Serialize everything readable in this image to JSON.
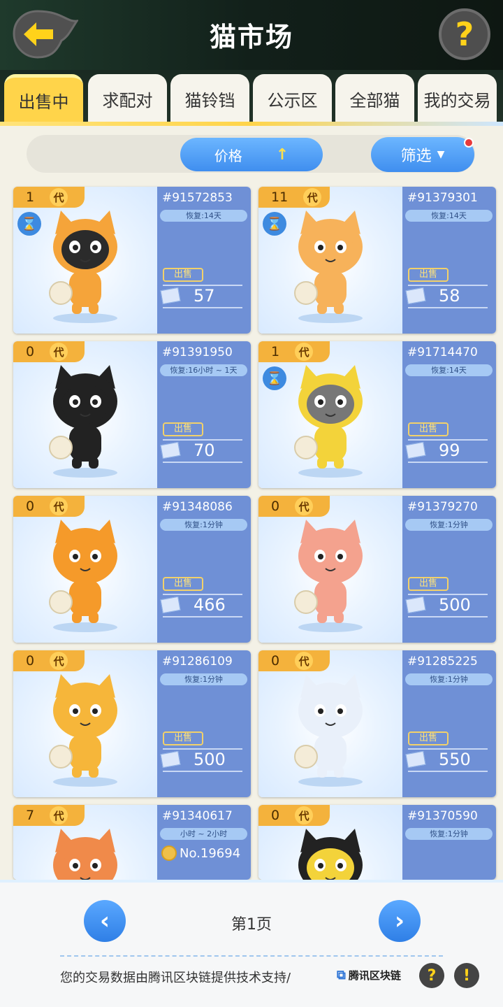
{
  "header": {
    "title": "猫市场",
    "back_icon": "back-arrow-icon",
    "help_label": "?"
  },
  "tabs": [
    {
      "label": "出售中",
      "active": true
    },
    {
      "label": "求配对",
      "active": false
    },
    {
      "label": "猫铃铛",
      "active": false
    },
    {
      "label": "公示区",
      "active": false
    },
    {
      "label": "全部猫",
      "active": false
    },
    {
      "label": "我的交易",
      "active": false
    }
  ],
  "sort": {
    "price_label": "价格",
    "price_arrow": "↑",
    "filter_label": "筛选",
    "filter_icon": "▼"
  },
  "cards": [
    {
      "gen": "1",
      "gen_tag": "代",
      "id": "#91572853",
      "recover": "恢复:14天",
      "sell": "出售",
      "price": "57",
      "hourglass": true,
      "color": "#f5a43a",
      "face": "#2b2b2b"
    },
    {
      "gen": "11",
      "gen_tag": "代",
      "id": "#91379301",
      "recover": "恢复:14天",
      "sell": "出售",
      "price": "58",
      "hourglass": true,
      "color": "#f7b25a",
      "face": "#f7b25a"
    },
    {
      "gen": "0",
      "gen_tag": "代",
      "id": "#91391950",
      "recover": "恢复:16小时 ~ 1天",
      "sell": "出售",
      "price": "70",
      "hourglass": false,
      "color": "#222222",
      "face": "#222222"
    },
    {
      "gen": "1",
      "gen_tag": "代",
      "id": "#91714470",
      "recover": "恢复:14天",
      "sell": "出售",
      "price": "99",
      "hourglass": true,
      "color": "#f3d33a",
      "face": "#777777"
    },
    {
      "gen": "0",
      "gen_tag": "代",
      "id": "#91348086",
      "recover": "恢复:1分钟",
      "sell": "出售",
      "price": "466",
      "hourglass": false,
      "color": "#f59a2a",
      "face": "#f59a2a"
    },
    {
      "gen": "0",
      "gen_tag": "代",
      "id": "#91379270",
      "recover": "恢复:1分钟",
      "sell": "出售",
      "price": "500",
      "hourglass": false,
      "color": "#f4a28e",
      "face": "#f4a28e"
    },
    {
      "gen": "0",
      "gen_tag": "代",
      "id": "#91286109",
      "recover": "恢复:1分钟",
      "sell": "出售",
      "price": "500",
      "hourglass": false,
      "color": "#f6b63a",
      "face": "#f6b63a"
    },
    {
      "gen": "0",
      "gen_tag": "代",
      "id": "#91285225",
      "recover": "恢复:1分钟",
      "sell": "出售",
      "price": "550",
      "hourglass": false,
      "color": "#e9f0fa",
      "face": "#e9f0fa"
    },
    {
      "gen": "7",
      "gen_tag": "代",
      "id": "#91340617",
      "recover": "小时 ~ 2小时",
      "no": "No.19694",
      "hourglass": false,
      "color": "#f08a4a",
      "face": "#f08a4a"
    },
    {
      "gen": "0",
      "gen_tag": "代",
      "id": "#91370590",
      "recover": "恢复:1分钟",
      "hourglass": false,
      "color": "#222222",
      "face": "#f3d33a"
    }
  ],
  "footer": {
    "prev": "‹",
    "next": "›",
    "page": "第1页",
    "notice": "您的交易数据由腾讯区块链提供技术支持/",
    "brand": "腾讯区块链",
    "brand_icon": "⧉",
    "help": "?",
    "alert": "!"
  }
}
